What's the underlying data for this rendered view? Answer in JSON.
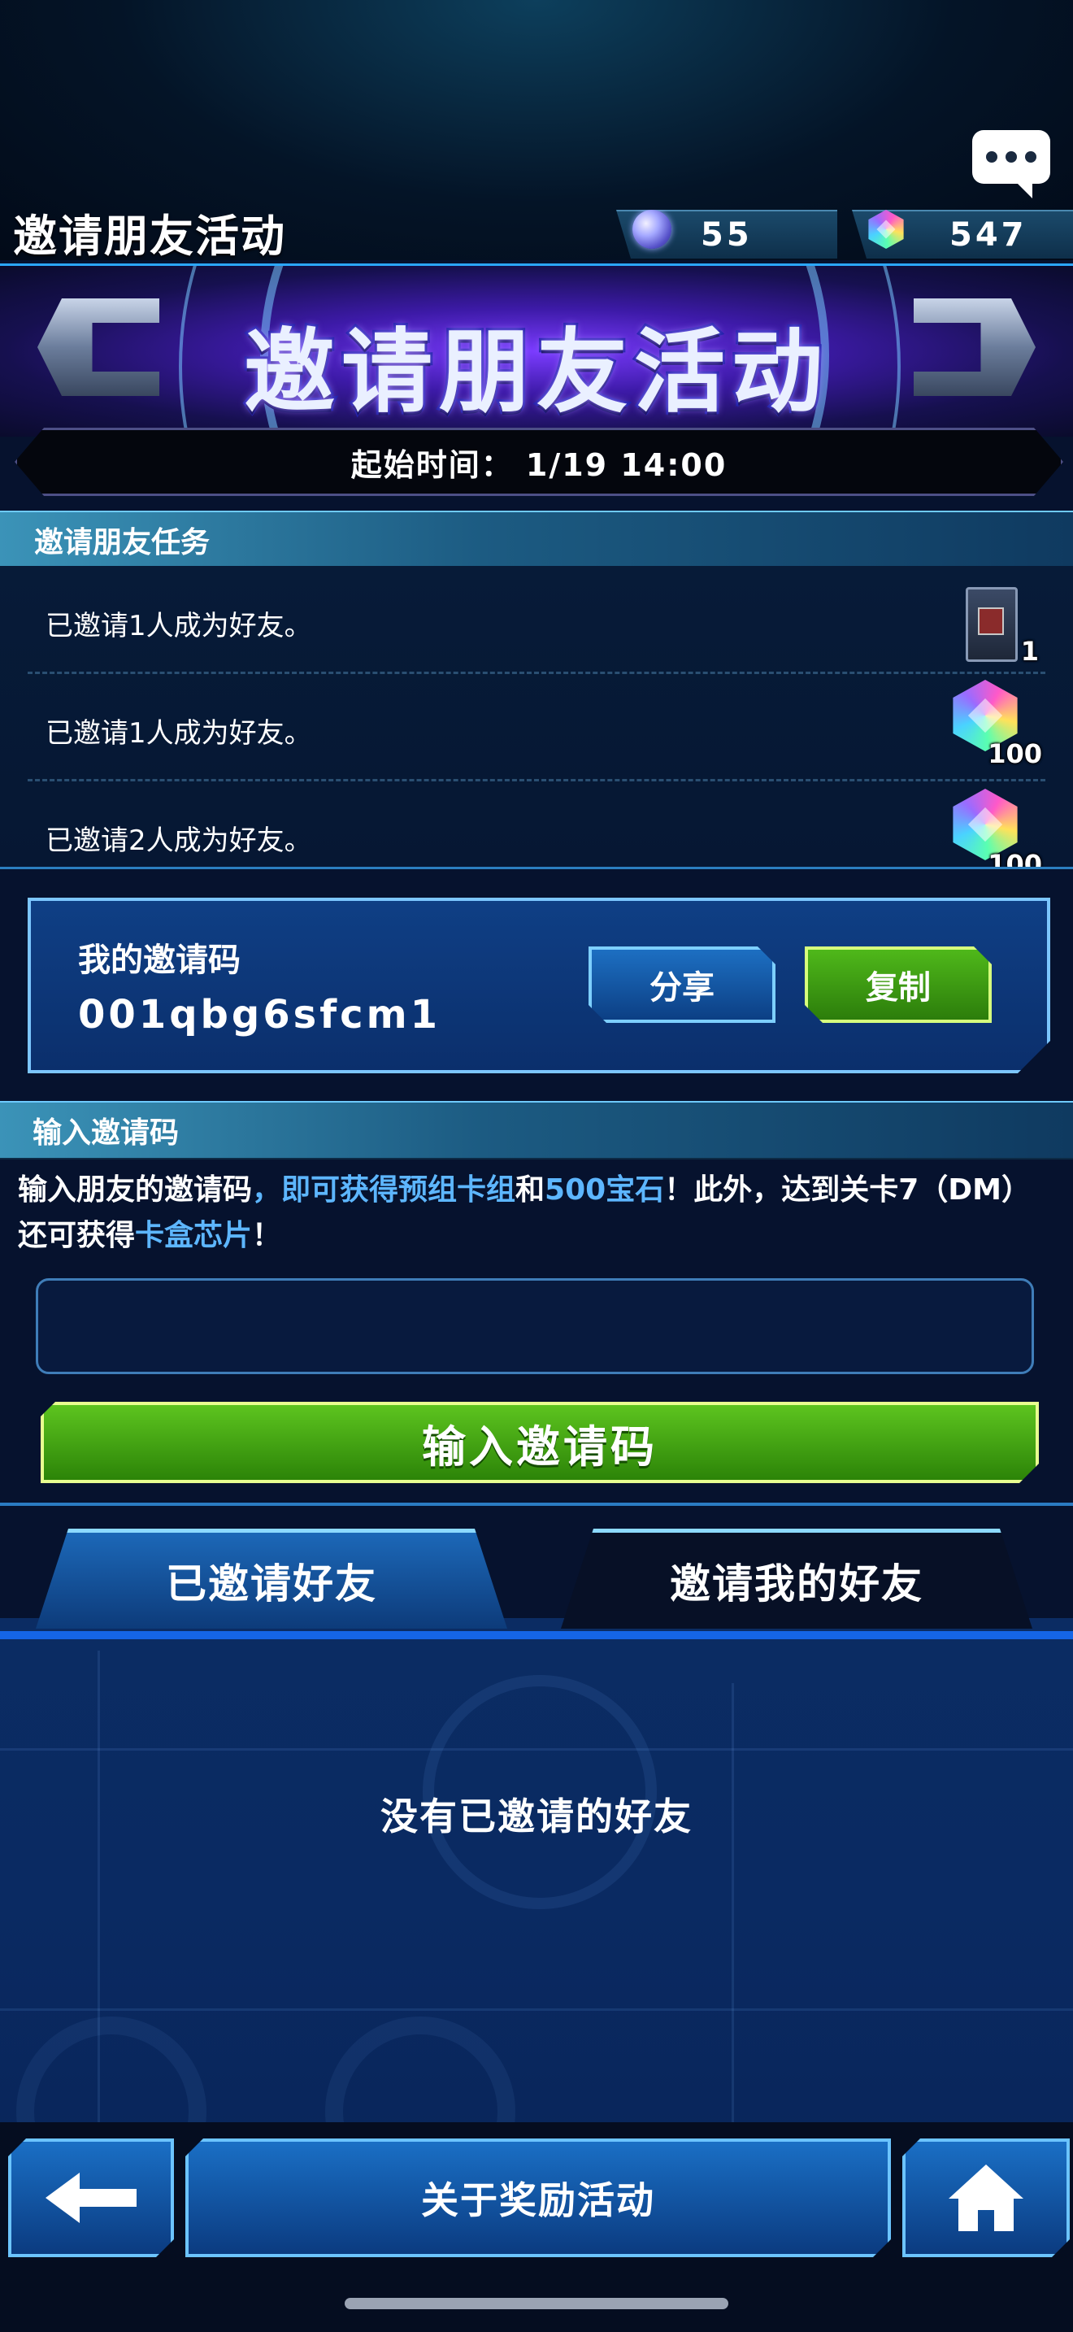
{
  "header": {
    "title": "邀请朋友活动"
  },
  "currency": {
    "orbs": "55",
    "gems": "547"
  },
  "banner": {
    "title": "邀请朋友活动",
    "start_time": "起始时间：  1/19 14:00"
  },
  "missions": {
    "heading": "邀请朋友任务",
    "items": [
      {
        "text": "已邀请1人成为好友。",
        "reward_icon": "card-pack-icon",
        "reward_qty": "1"
      },
      {
        "text": "已邀请1人成为好友。",
        "reward_icon": "gem-icon",
        "reward_qty": "100"
      },
      {
        "text": "已邀请2人成为好友。",
        "reward_icon": "gem-icon",
        "reward_qty": "100"
      }
    ]
  },
  "my_code": {
    "label": "我的邀请码",
    "value": "001qbg6sfcm1",
    "share_label": "分享",
    "copy_label": "复制"
  },
  "enter_code": {
    "heading": "输入邀请码",
    "desc_parts": [
      "输入朋友的邀请码",
      "，即可获得预组卡组",
      "和",
      "500宝石",
      "！此外，达到关卡7（DM）还可获得",
      "卡盒芯片",
      "！"
    ],
    "input_value": "",
    "input_placeholder": "",
    "button_label": "输入邀请码"
  },
  "tabs": {
    "invited": "已邀请好友",
    "inviter": "邀请我的好友"
  },
  "empty_message": "没有已邀请的好友",
  "bottom": {
    "about_label": "关于奖励活动"
  },
  "colors": {
    "accent": "#5db6ff",
    "green": "#4fb81a",
    "blue": "#1565e6"
  }
}
